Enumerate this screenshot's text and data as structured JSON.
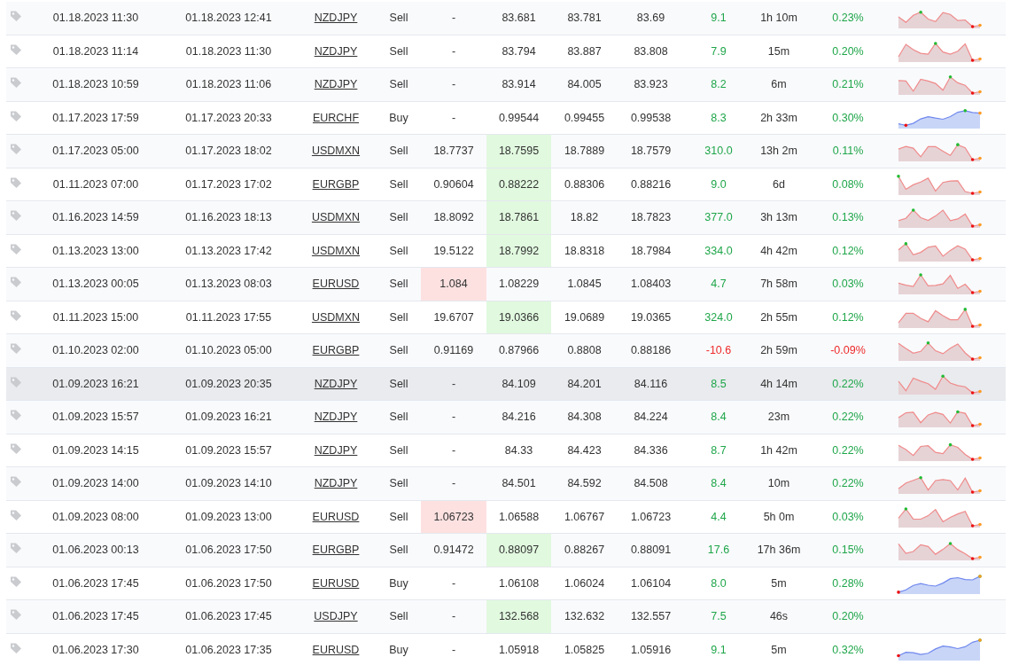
{
  "trades": [
    {
      "open_time": "01.18.2023 11:30",
      "close_time": "01.18.2023 12:41",
      "symbol": "NZDJPY",
      "type": "Sell",
      "column_5": "-",
      "column_6": "83.681",
      "column_7": "83.781",
      "column_8": "83.69",
      "pips": "9.1",
      "duration": "1h 10m",
      "change": "0.23%",
      "loss": false,
      "column_5_hit": false,
      "column_6_hit": false,
      "highlighted": false,
      "kind": "sell"
    },
    {
      "open_time": "01.18.2023 11:14",
      "close_time": "01.18.2023 11:30",
      "symbol": "NZDJPY",
      "type": "Sell",
      "column_5": "-",
      "column_6": "83.794",
      "column_7": "83.887",
      "column_8": "83.808",
      "pips": "7.9",
      "duration": "15m",
      "change": "0.20%",
      "loss": false,
      "column_5_hit": false,
      "column_6_hit": false,
      "highlighted": false,
      "kind": "sell"
    },
    {
      "open_time": "01.18.2023 10:59",
      "close_time": "01.18.2023 11:06",
      "symbol": "NZDJPY",
      "type": "Sell",
      "column_5": "-",
      "column_6": "83.914",
      "column_7": "84.005",
      "column_8": "83.923",
      "pips": "8.2",
      "duration": "6m",
      "change": "0.21%",
      "loss": false,
      "column_5_hit": false,
      "column_6_hit": false,
      "highlighted": false,
      "kind": "sell"
    },
    {
      "open_time": "01.17.2023 17:59",
      "close_time": "01.17.2023 20:33",
      "symbol": "EURCHF",
      "type": "Buy",
      "column_5": "-",
      "column_6": "0.99544",
      "column_7": "0.99455",
      "column_8": "0.99538",
      "pips": "8.3",
      "duration": "2h 33m",
      "change": "0.30%",
      "loss": false,
      "column_5_hit": false,
      "column_6_hit": false,
      "highlighted": false,
      "kind": "buy"
    },
    {
      "open_time": "01.17.2023 05:00",
      "close_time": "01.17.2023 18:02",
      "symbol": "USDMXN",
      "type": "Sell",
      "column_5": "18.7737",
      "column_6": "18.7595",
      "column_7": "18.7889",
      "column_8": "18.7579",
      "pips": "310.0",
      "duration": "13h 2m",
      "change": "0.11%",
      "loss": false,
      "column_5_hit": false,
      "column_6_hit": true,
      "highlighted": false,
      "kind": "sell"
    },
    {
      "open_time": "01.11.2023 07:00",
      "close_time": "01.17.2023 17:02",
      "symbol": "EURGBP",
      "type": "Sell",
      "column_5": "0.90604",
      "column_6": "0.88222",
      "column_7": "0.88306",
      "column_8": "0.88216",
      "pips": "9.0",
      "duration": "6d",
      "change": "0.08%",
      "loss": false,
      "column_5_hit": false,
      "column_6_hit": true,
      "highlighted": false,
      "kind": "sell"
    },
    {
      "open_time": "01.16.2023 14:59",
      "close_time": "01.16.2023 18:13",
      "symbol": "USDMXN",
      "type": "Sell",
      "column_5": "18.8092",
      "column_6": "18.7861",
      "column_7": "18.82",
      "column_8": "18.7823",
      "pips": "377.0",
      "duration": "3h 13m",
      "change": "0.13%",
      "loss": false,
      "column_5_hit": false,
      "column_6_hit": true,
      "highlighted": false,
      "kind": "sell"
    },
    {
      "open_time": "01.13.2023 13:00",
      "close_time": "01.13.2023 17:42",
      "symbol": "USDMXN",
      "type": "Sell",
      "column_5": "19.5122",
      "column_6": "18.7992",
      "column_7": "18.8318",
      "column_8": "18.7984",
      "pips": "334.0",
      "duration": "4h 42m",
      "change": "0.12%",
      "loss": false,
      "column_5_hit": false,
      "column_6_hit": true,
      "highlighted": false,
      "kind": "sell"
    },
    {
      "open_time": "01.13.2023 00:05",
      "close_time": "01.13.2023 08:03",
      "symbol": "EURUSD",
      "type": "Sell",
      "column_5": "1.084",
      "column_6": "1.08229",
      "column_7": "1.0845",
      "column_8": "1.08403",
      "pips": "4.7",
      "duration": "7h 58m",
      "change": "0.03%",
      "loss": false,
      "column_5_hit": true,
      "column_6_hit": false,
      "highlighted": false,
      "kind": "sell"
    },
    {
      "open_time": "01.11.2023 15:00",
      "close_time": "01.11.2023 17:55",
      "symbol": "USDMXN",
      "type": "Sell",
      "column_5": "19.6707",
      "column_6": "19.0366",
      "column_7": "19.0689",
      "column_8": "19.0365",
      "pips": "324.0",
      "duration": "2h 55m",
      "change": "0.12%",
      "loss": false,
      "column_5_hit": false,
      "column_6_hit": true,
      "highlighted": false,
      "kind": "sell"
    },
    {
      "open_time": "01.10.2023 02:00",
      "close_time": "01.10.2023 05:00",
      "symbol": "EURGBP",
      "type": "Sell",
      "column_5": "0.91169",
      "column_6": "0.87966",
      "column_7": "0.8808",
      "column_8": "0.88186",
      "pips": "-10.6",
      "duration": "2h 59m",
      "change": "-0.09%",
      "loss": true,
      "column_5_hit": false,
      "column_6_hit": false,
      "highlighted": false,
      "kind": "sell"
    },
    {
      "open_time": "01.09.2023 16:21",
      "close_time": "01.09.2023 20:35",
      "symbol": "NZDJPY",
      "type": "Sell",
      "column_5": "-",
      "column_6": "84.109",
      "column_7": "84.201",
      "column_8": "84.116",
      "pips": "8.5",
      "duration": "4h 14m",
      "change": "0.22%",
      "loss": false,
      "column_5_hit": false,
      "column_6_hit": false,
      "highlighted": true,
      "kind": "sell"
    },
    {
      "open_time": "01.09.2023 15:57",
      "close_time": "01.09.2023 16:21",
      "symbol": "NZDJPY",
      "type": "Sell",
      "column_5": "-",
      "column_6": "84.216",
      "column_7": "84.308",
      "column_8": "84.224",
      "pips": "8.4",
      "duration": "23m",
      "change": "0.22%",
      "loss": false,
      "column_5_hit": false,
      "column_6_hit": false,
      "highlighted": false,
      "kind": "sell"
    },
    {
      "open_time": "01.09.2023 14:15",
      "close_time": "01.09.2023 15:57",
      "symbol": "NZDJPY",
      "type": "Sell",
      "column_5": "-",
      "column_6": "84.33",
      "column_7": "84.423",
      "column_8": "84.336",
      "pips": "8.7",
      "duration": "1h 42m",
      "change": "0.22%",
      "loss": false,
      "column_5_hit": false,
      "column_6_hit": false,
      "highlighted": false,
      "kind": "sell"
    },
    {
      "open_time": "01.09.2023 14:00",
      "close_time": "01.09.2023 14:10",
      "symbol": "NZDJPY",
      "type": "Sell",
      "column_5": "-",
      "column_6": "84.501",
      "column_7": "84.592",
      "column_8": "84.508",
      "pips": "8.4",
      "duration": "10m",
      "change": "0.22%",
      "loss": false,
      "column_5_hit": false,
      "column_6_hit": false,
      "highlighted": false,
      "kind": "sell"
    },
    {
      "open_time": "01.09.2023 08:00",
      "close_time": "01.09.2023 13:00",
      "symbol": "EURUSD",
      "type": "Sell",
      "column_5": "1.06723",
      "column_6": "1.06588",
      "column_7": "1.06767",
      "column_8": "1.06723",
      "pips": "4.4",
      "duration": "5h 0m",
      "change": "0.03%",
      "loss": false,
      "column_5_hit": true,
      "column_6_hit": false,
      "highlighted": false,
      "kind": "sell"
    },
    {
      "open_time": "01.06.2023 00:13",
      "close_time": "01.06.2023 17:50",
      "symbol": "EURGBP",
      "type": "Sell",
      "column_5": "0.91472",
      "column_6": "0.88097",
      "column_7": "0.88267",
      "column_8": "0.88091",
      "pips": "17.6",
      "duration": "17h 36m",
      "change": "0.15%",
      "loss": false,
      "column_5_hit": false,
      "column_6_hit": true,
      "highlighted": false,
      "kind": "sell"
    },
    {
      "open_time": "01.06.2023 17:45",
      "close_time": "01.06.2023 17:50",
      "symbol": "EURUSD",
      "type": "Buy",
      "column_5": "-",
      "column_6": "1.06108",
      "column_7": "1.06024",
      "column_8": "1.06104",
      "pips": "8.0",
      "duration": "5m",
      "change": "0.28%",
      "loss": false,
      "column_5_hit": false,
      "column_6_hit": false,
      "highlighted": false,
      "kind": "buy"
    },
    {
      "open_time": "01.06.2023 17:45",
      "close_time": "01.06.2023 17:45",
      "symbol": "USDJPY",
      "type": "Sell",
      "column_5": "-",
      "column_6": "132.568",
      "column_7": "132.632",
      "column_8": "132.557",
      "pips": "7.5",
      "duration": "46s",
      "change": "0.20%",
      "loss": false,
      "column_5_hit": false,
      "column_6_hit": true,
      "highlighted": false
    },
    {
      "open_time": "01.06.2023 17:30",
      "close_time": "01.06.2023 17:35",
      "symbol": "EURUSD",
      "type": "Buy",
      "column_5": "-",
      "column_6": "1.05918",
      "column_7": "1.05825",
      "column_8": "1.05916",
      "pips": "9.1",
      "duration": "5m",
      "change": "0.32%",
      "loss": false,
      "column_5_hit": false,
      "column_6_hit": false,
      "highlighted": false,
      "kind": "buy"
    }
  ]
}
